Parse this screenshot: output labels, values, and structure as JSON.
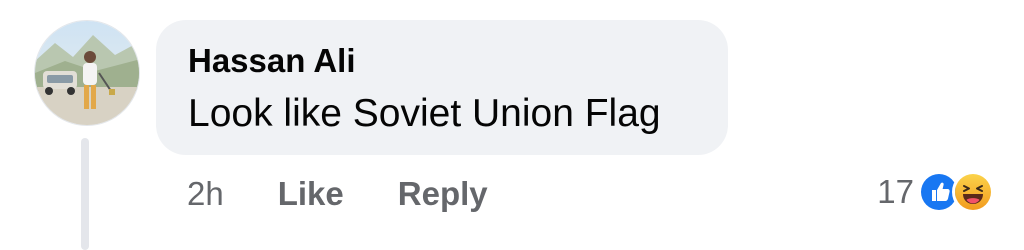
{
  "comment": {
    "author": "Hassan Ali",
    "text": "Look like Soviet Union Flag",
    "timestamp": "2h",
    "like_label": "Like",
    "reply_label": "Reply",
    "reaction_count": "17",
    "reaction_icons": [
      "like-icon",
      "haha-icon"
    ],
    "avatar_icon": "avatar"
  },
  "colors": {
    "bubble": "#f0f2f5",
    "text_primary": "#050505",
    "text_secondary": "#65676b",
    "like_blue": "#1877f2",
    "haha_yellow": "#f7b125",
    "thread_line": "#e4e6eb"
  }
}
